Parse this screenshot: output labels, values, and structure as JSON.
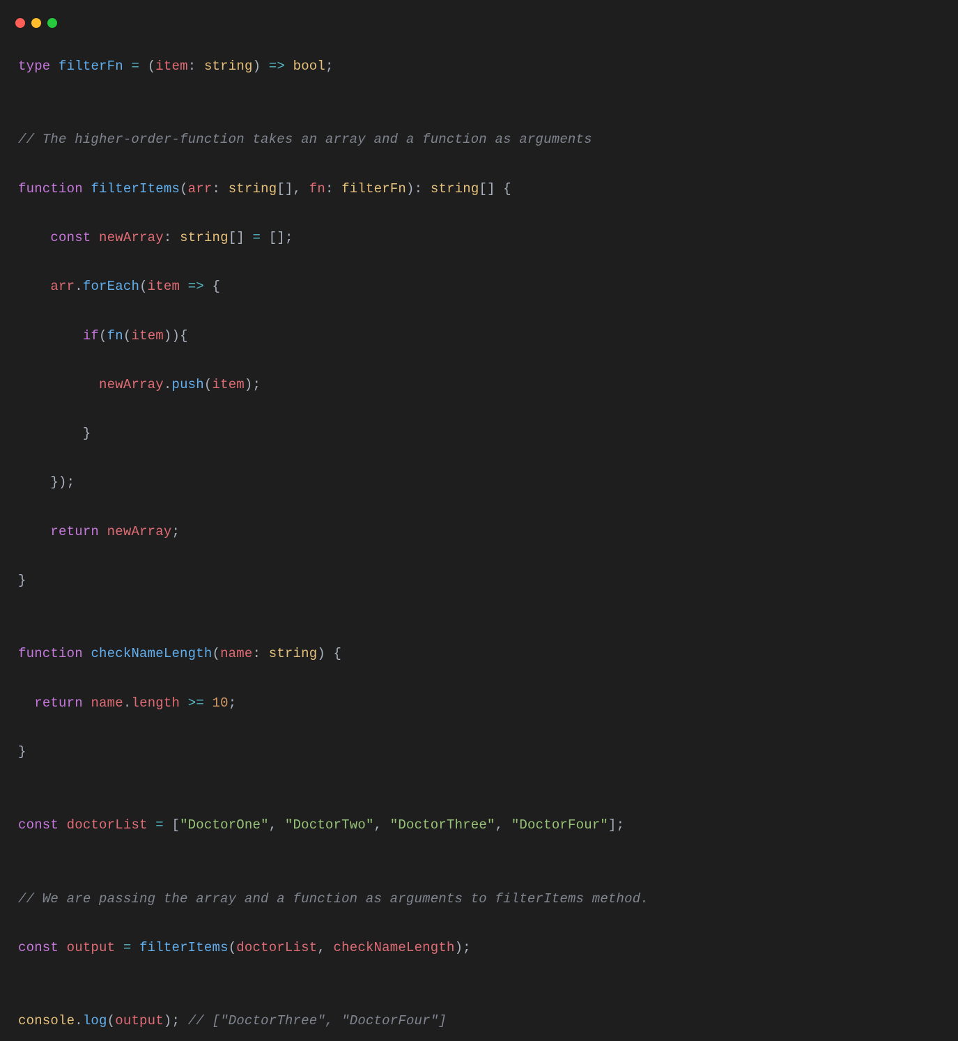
{
  "titlebar": {
    "buttons": [
      "close",
      "minimize",
      "zoom"
    ]
  },
  "code": {
    "l1": {
      "kw_type": "type",
      "name": "filterFn",
      "eq": "=",
      "lp": "(",
      "param": "item",
      "colon": ": ",
      "ptype": "string",
      "rp": ")",
      "arrow": " => ",
      "ret": "bool",
      "semi": ";"
    },
    "l2": "",
    "l3": {
      "cmt": "// The higher-order-function takes an array and a function as arguments"
    },
    "l4": {
      "kw_fn": "function",
      "name": "filterItems",
      "lp": "(",
      "p1": "arr",
      "c1": ": ",
      "t1": "string",
      "br1": "[]",
      "comma": ", ",
      "p2": "fn",
      "c2": ": ",
      "t2": "filterFn",
      "rp": ")",
      "c3": ": ",
      "rt": "string",
      "br2": "[]",
      "lb": " {"
    },
    "l5": {
      "indent": "    ",
      "kw": "const",
      "sp": " ",
      "name": "newArray",
      "colon": ": ",
      "type": "string",
      "br": "[]",
      "eq": " = ",
      "val": "[]",
      "semi": ";"
    },
    "l6": {
      "indent": "    ",
      "obj": "arr",
      "dot": ".",
      "meth": "forEach",
      "lp": "(",
      "param": "item",
      "arrow": " => ",
      "lb": "{"
    },
    "l7": {
      "indent": "        ",
      "kw": "if",
      "lp": "(",
      "fn": "fn",
      "lp2": "(",
      "arg": "item",
      "rp": ")){"
    },
    "l8": {
      "indent": "          ",
      "obj": "newArray",
      "dot": ".",
      "meth": "push",
      "lp": "(",
      "arg": "item",
      "rp": ");"
    },
    "l9": {
      "indent": "        ",
      "rb": "}"
    },
    "l10": {
      "indent": "    ",
      "rb": "});"
    },
    "l11": {
      "indent": "    ",
      "kw": "return",
      "sp": " ",
      "name": "newArray",
      "semi": ";"
    },
    "l12": {
      "rb": "}"
    },
    "l13": "",
    "l14": {
      "kw_fn": "function",
      "name": "checkNameLength",
      "lp": "(",
      "p1": "name",
      "c1": ": ",
      "t1": "string",
      "rp": ") {"
    },
    "l15": {
      "indent": "  ",
      "kw": "return",
      "sp": " ",
      "obj": "name",
      "dot": ".",
      "prop": "length",
      "op": " >= ",
      "num": "10",
      "semi": ";"
    },
    "l16": {
      "rb": "}"
    },
    "l17": "",
    "l18": {
      "kw": "const",
      "sp": " ",
      "name": "doctorList",
      "eq": " = ",
      "lb": "[",
      "s1": "\"DoctorOne\"",
      "c1": ", ",
      "s2": "\"DoctorTwo\"",
      "c2": ", ",
      "s3": "\"DoctorThree\"",
      "c3": ", ",
      "s4": "\"DoctorFour\"",
      "rb": "];"
    },
    "l19": "",
    "l20": {
      "cmt": "// We are passing the array and a function as arguments to filterItems method."
    },
    "l21": {
      "kw": "const",
      "sp": " ",
      "name": "output",
      "eq": " = ",
      "fn": "filterItems",
      "lp": "(",
      "a1": "doctorList",
      "comma": ", ",
      "a2": "checkNameLength",
      "rp": ");"
    },
    "l22": "",
    "l23": {
      "obj": "console",
      "dot": ".",
      "meth": "log",
      "lp": "(",
      "arg": "output",
      "rp": ");",
      "sp": " ",
      "cmt": "// [\"DoctorThree\", \"DoctorFour\"]"
    }
  }
}
